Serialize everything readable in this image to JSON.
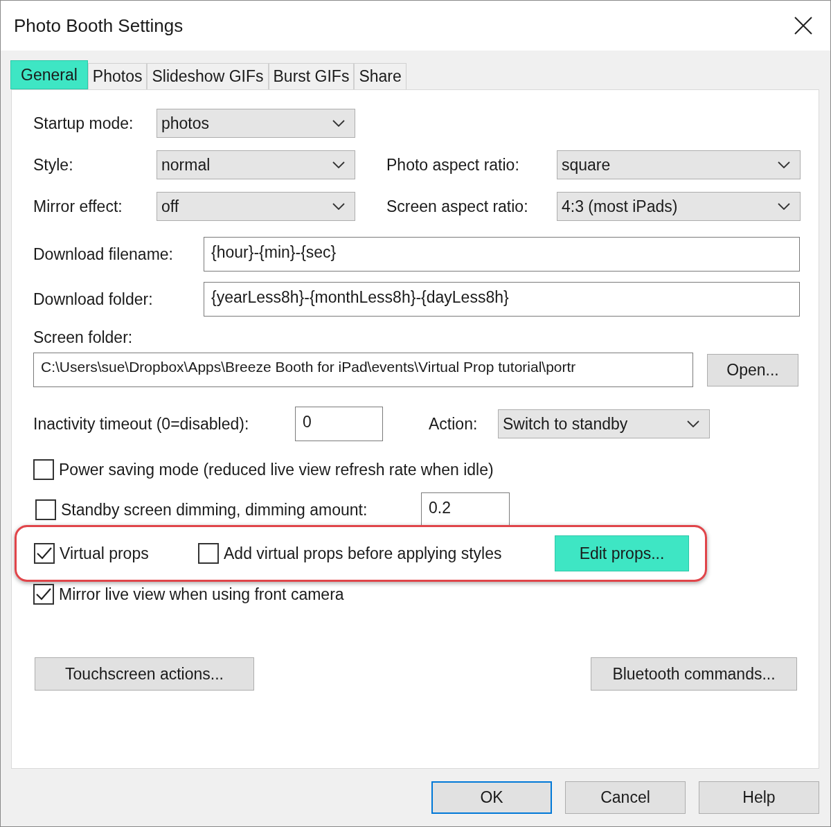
{
  "window": {
    "title": "Photo Booth Settings"
  },
  "tabs": [
    {
      "label": "General",
      "selected": true
    },
    {
      "label": "Photos",
      "selected": false
    },
    {
      "label": "Slideshow GIFs",
      "selected": false
    },
    {
      "label": "Burst GIFs",
      "selected": false
    },
    {
      "label": "Share",
      "selected": false
    }
  ],
  "startup_mode": {
    "label": "Startup mode:",
    "value": "photos"
  },
  "style": {
    "label": "Style:",
    "value": "normal"
  },
  "photo_aspect_ratio": {
    "label": "Photo aspect ratio:",
    "value": "square"
  },
  "mirror_effect": {
    "label": "Mirror effect:",
    "value": "off"
  },
  "screen_aspect_ratio": {
    "label": "Screen aspect ratio:",
    "value": "4:3 (most iPads)"
  },
  "download_filename": {
    "label": "Download filename:",
    "value": "{hour}-{min}-{sec}"
  },
  "download_folder": {
    "label": "Download folder:",
    "value": "{yearLess8h}-{monthLess8h}-{dayLess8h}"
  },
  "screen_folder": {
    "label": "Screen folder:",
    "value": "C:\\Users\\sue\\Dropbox\\Apps\\Breeze Booth for iPad\\events\\Virtual Prop tutorial\\portr",
    "button": "Open..."
  },
  "inactivity_timeout": {
    "label": "Inactivity timeout (0=disabled):",
    "value": "0"
  },
  "action": {
    "label": "Action:",
    "value": "Switch to standby"
  },
  "power_saving": {
    "label": "Power saving mode (reduced live view refresh rate when idle)",
    "checked": false
  },
  "standby_dimming": {
    "label": "Standby screen dimming, dimming amount:",
    "checked": false,
    "value": "0.2"
  },
  "props_row": {
    "outlined": true,
    "virtual_props": {
      "label": "Virtual props",
      "checked": true
    },
    "add_before_styles": {
      "label": "Add virtual props before applying styles",
      "checked": false
    },
    "edit_button": {
      "label": "Edit props...",
      "highlighted": true
    }
  },
  "mirror_live_view": {
    "label": "Mirror live view when using front camera",
    "checked": true
  },
  "touchscreen_button": "Touchscreen actions...",
  "bluetooth_button": "Bluetooth commands...",
  "footer_buttons": [
    {
      "label": "OK",
      "default": true
    },
    {
      "label": "Cancel",
      "default": false
    },
    {
      "label": "Help",
      "default": false
    }
  ]
}
